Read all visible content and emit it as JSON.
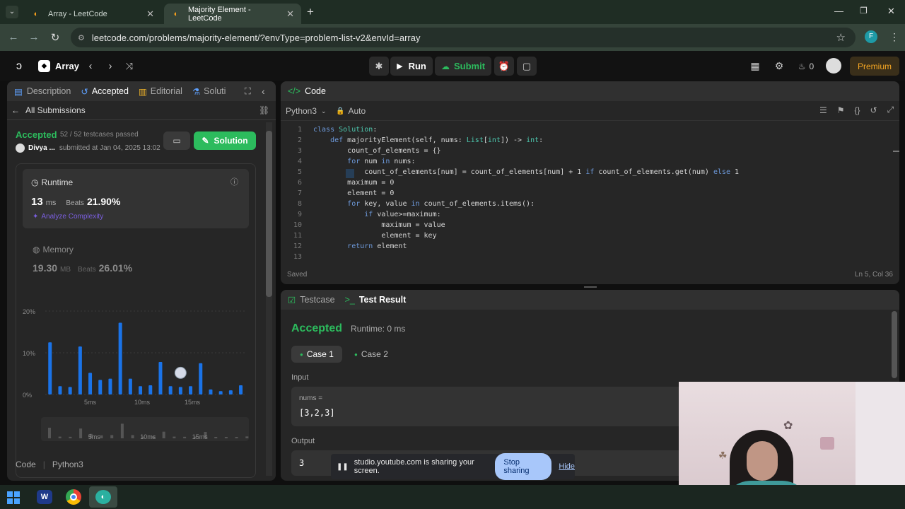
{
  "browser": {
    "tabs": [
      {
        "title": "Array - LeetCode",
        "active": false
      },
      {
        "title": "Majority Element - LeetCode",
        "active": true
      }
    ],
    "url": "leetcode.com/problems/majority-element/?envType=problem-list-v2&envId=array",
    "profile_initial": "F"
  },
  "header": {
    "list_name": "Array",
    "run_label": "Run",
    "submit_label": "Submit",
    "streak_count": "0",
    "premium_label": "Premium"
  },
  "left": {
    "tabs": [
      "Description",
      "Accepted",
      "Editorial",
      "Soluti"
    ],
    "back_label": "All Submissions",
    "status": "Accepted",
    "testcases": "52 / 52 testcases passed",
    "user": "Divya ...",
    "submitted": "submitted at Jan 04, 2025 13:02",
    "solution_label": "Solution",
    "runtime": {
      "label": "Runtime",
      "value": "13",
      "unit": "ms",
      "beats_label": "Beats",
      "beats": "21.90%",
      "analyze": "Analyze Complexity"
    },
    "memory": {
      "label": "Memory",
      "value": "19.30",
      "unit": "MB",
      "beats_label": "Beats",
      "beats": "26.01%"
    },
    "code_label": "Code",
    "lang_label": "Python3"
  },
  "chart_data": {
    "type": "bar",
    "y_ticks": [
      "20%",
      "10%",
      "0%"
    ],
    "x_ticks": [
      "5ms",
      "10ms",
      "15ms"
    ],
    "ylim": [
      0,
      20
    ],
    "values": [
      12.5,
      2,
      1.8,
      11.5,
      5.2,
      3.5,
      3.8,
      17.2,
      3.8,
      2,
      2.2,
      7.8,
      2,
      1.8,
      2,
      7.5,
      1.2,
      0.8,
      1,
      2.2
    ],
    "highlight_index": 13,
    "accent": "#1a73e8"
  },
  "editor": {
    "title": "Code",
    "language": "Python3",
    "mode": "Auto",
    "saved_label": "Saved",
    "cursor": "Ln 5, Col 36",
    "lines": [
      {
        "n": "1",
        "t": "class Solution:"
      },
      {
        "n": "2",
        "t": "    def majorityElement(self, nums: List[int]) -> int:"
      },
      {
        "n": "3",
        "t": "        count_of_elements = {}"
      },
      {
        "n": "4",
        "t": "        for num in nums:"
      },
      {
        "n": "5",
        "t": "            count_of_elements[num] = count_of_elements[num] + 1 if count_of_elements.get(num) else 1"
      },
      {
        "n": "6",
        "t": "        maximum = 0"
      },
      {
        "n": "7",
        "t": "        element = 0"
      },
      {
        "n": "8",
        "t": "        for key, value in count_of_elements.items():"
      },
      {
        "n": "9",
        "t": "            if value>=maximum:"
      },
      {
        "n": "10",
        "t": "                maximum = value"
      },
      {
        "n": "11",
        "t": "                element = key"
      },
      {
        "n": "12",
        "t": "        return element"
      },
      {
        "n": "13",
        "t": ""
      }
    ]
  },
  "result": {
    "tab_testcase": "Testcase",
    "tab_result": "Test Result",
    "status": "Accepted",
    "runtime": "Runtime: 0 ms",
    "case1": "Case 1",
    "case2": "Case 2",
    "input_label": "Input",
    "var_label": "nums =",
    "input_value": "[3,2,3]",
    "output_label": "Output",
    "output_value": "3"
  },
  "share": {
    "message": "studio.youtube.com is sharing your screen.",
    "stop": "Stop sharing",
    "hide": "Hide"
  }
}
